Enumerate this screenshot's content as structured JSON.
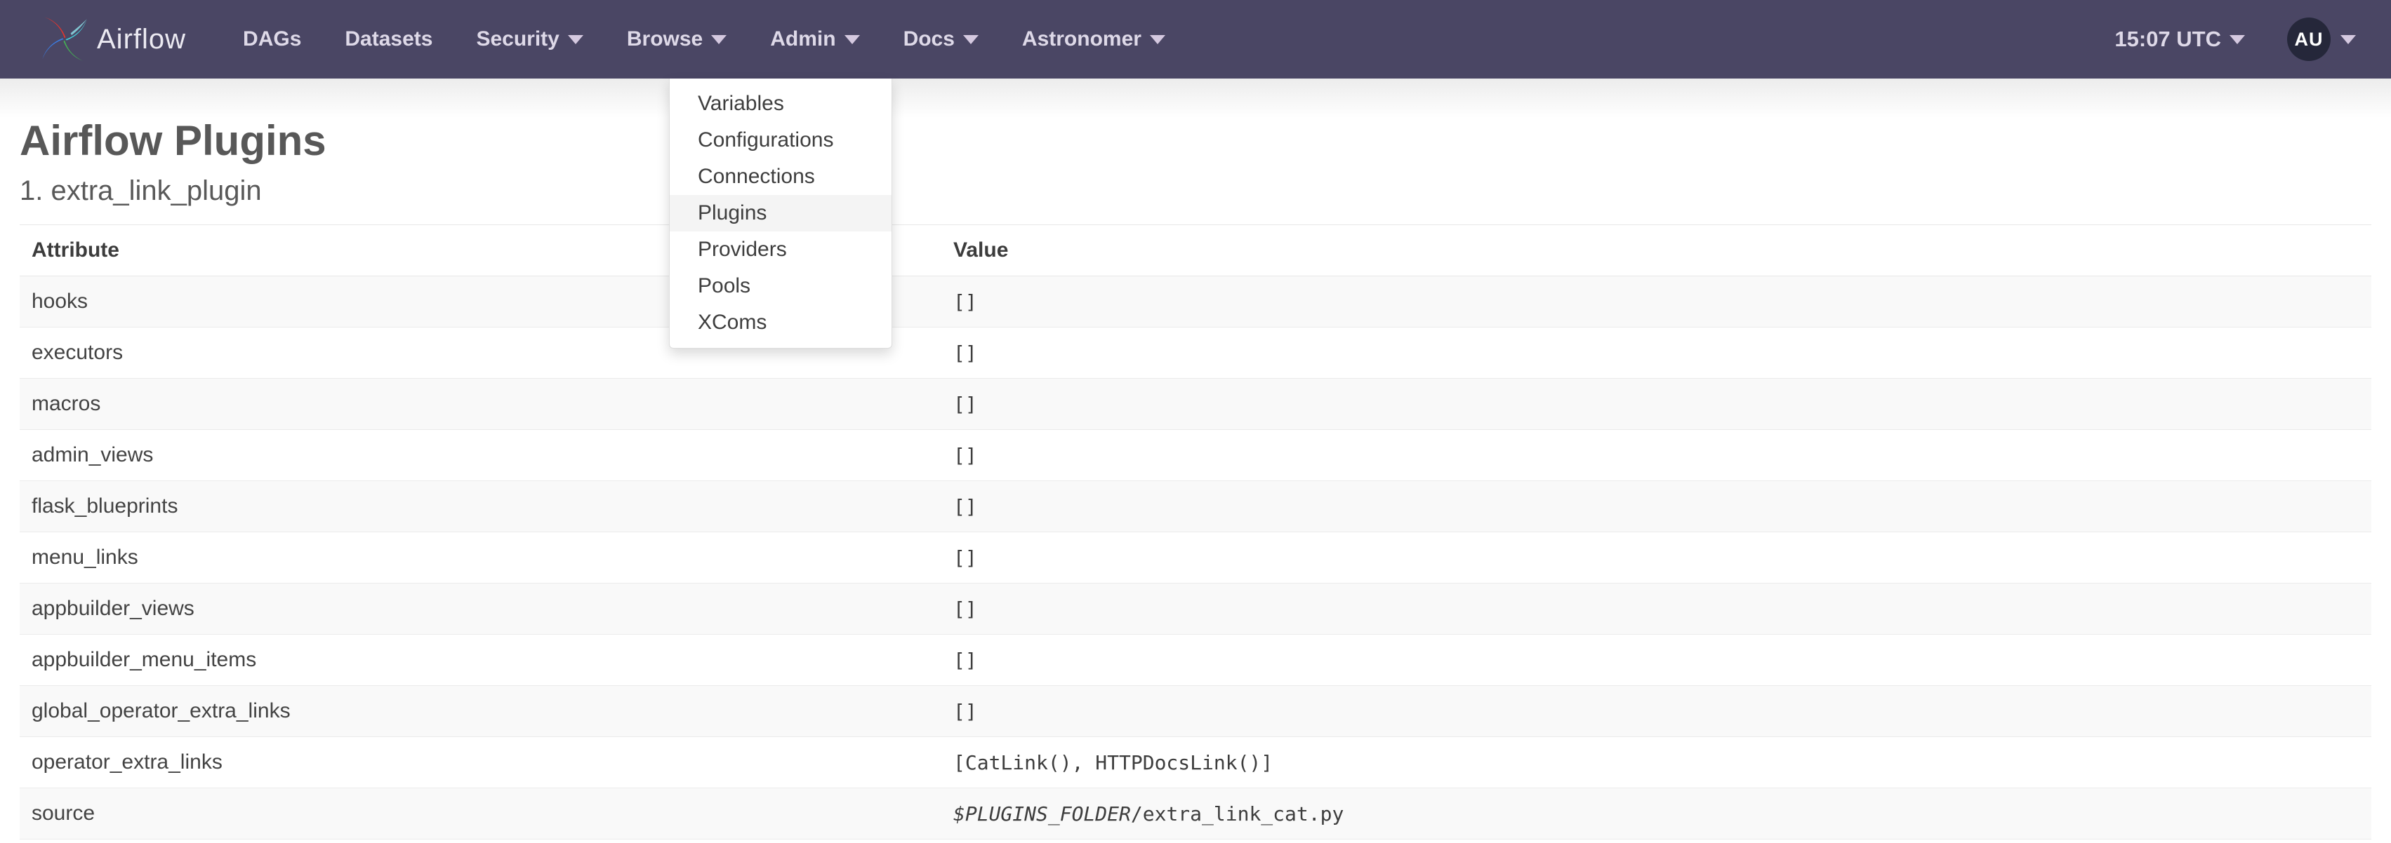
{
  "navbar": {
    "brand": "Airflow",
    "items": [
      {
        "label": "DAGs",
        "caret": false
      },
      {
        "label": "Datasets",
        "caret": false
      },
      {
        "label": "Security",
        "caret": true
      },
      {
        "label": "Browse",
        "caret": true
      },
      {
        "label": "Admin",
        "caret": true
      },
      {
        "label": "Docs",
        "caret": true
      },
      {
        "label": "Astronomer",
        "caret": true
      }
    ],
    "clock": "15:07 UTC",
    "avatar_initials": "AU"
  },
  "admin_menu": {
    "items": [
      "Variables",
      "Configurations",
      "Connections",
      "Plugins",
      "Providers",
      "Pools",
      "XComs"
    ],
    "active_item": "Plugins"
  },
  "page": {
    "title": "Airflow Plugins",
    "subtitle_index": "1.",
    "subtitle_name": "extra_link_plugin"
  },
  "table": {
    "columns": [
      "Attribute",
      "Value"
    ],
    "rows": [
      {
        "attribute": "hooks",
        "value": "[]"
      },
      {
        "attribute": "executors",
        "value": "[]"
      },
      {
        "attribute": "macros",
        "value": "[]"
      },
      {
        "attribute": "admin_views",
        "value": "[]"
      },
      {
        "attribute": "flask_blueprints",
        "value": "[]"
      },
      {
        "attribute": "menu_links",
        "value": "[]"
      },
      {
        "attribute": "appbuilder_views",
        "value": "[]"
      },
      {
        "attribute": "appbuilder_menu_items",
        "value": "[]"
      },
      {
        "attribute": "global_operator_extra_links",
        "value": "[]"
      },
      {
        "attribute": "operator_extra_links",
        "value": "[CatLink(), HTTPDocsLink()]"
      },
      {
        "attribute": "source",
        "value_em": "$PLUGINS_FOLDER",
        "value": "/extra_link_cat.py"
      }
    ]
  },
  "colors": {
    "navbar-bg": "#4a4664",
    "nav-text": "#ded9e8",
    "caret": "#d5c9e0",
    "avatar-bg": "#25273a",
    "heading": "#585858",
    "menu-active": "#f4f4f4",
    "stripe": "#f9f9f9",
    "border": "#ebebeb"
  }
}
